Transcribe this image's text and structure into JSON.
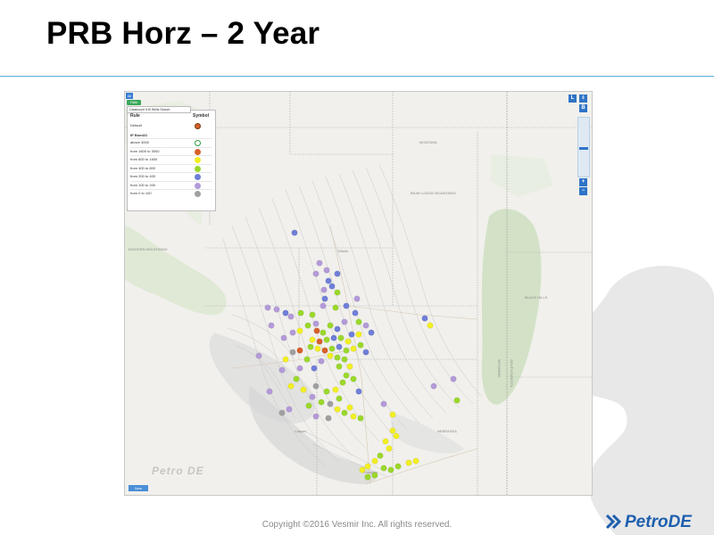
{
  "slide": {
    "title": "PRB Horz – 2 Year",
    "copyright": "Copyright ©2016 Vesmir Inc. All rights reserved.",
    "logo_text_petro": "Petro",
    "logo_text_de": "DE",
    "accent_color": "#5aaed6",
    "logo_color": "#1d5fae"
  },
  "map": {
    "all_button": "All",
    "hide_button": "Hide",
    "layer_select": "Catamount IHS Wells Search",
    "btn_l": "L",
    "btn_download": "⇩",
    "btn_b": "B",
    "zoom_in": "+",
    "zoom_out": "−",
    "bottom_button": "Now",
    "watermark": "Petro DE",
    "place_labels": [
      "MONTANA",
      "BEAR LODGE MOUNTAINS",
      "BLACK HILLS",
      "Gillette",
      "Douglas",
      "WYOMING",
      "SOUTH DAKOTA",
      "BIGHORN MOUNTAINS",
      "NEBRASKA",
      "Casper"
    ]
  },
  "legend": {
    "col_rule": "Rule",
    "col_symbol": "Symbol",
    "default_label": "Default",
    "group_label": "IP Boed21",
    "items": [
      {
        "label": "above 3000",
        "color": "#ffffff",
        "stroke": "#2ea043"
      },
      {
        "label": "from 1600 to 3000",
        "color": "#d6602a"
      },
      {
        "label": "from 800 to 1600",
        "color": "#f2ee22"
      },
      {
        "label": "from 400 to 800",
        "color": "#9ad82a"
      },
      {
        "label": "from 200 to 400",
        "color": "#6f7fd8"
      },
      {
        "label": "from 100 to 200",
        "color": "#b39ad8"
      },
      {
        "label": "from 0 to 100",
        "color": "#a0a0a0"
      }
    ]
  },
  "well_colors": {
    "orange": "#d6602a",
    "yellow": "#f2ee22",
    "green": "#9ad82a",
    "blue": "#6f7fd8",
    "lavender": "#b39ad8",
    "gray": "#a0a0a0"
  }
}
